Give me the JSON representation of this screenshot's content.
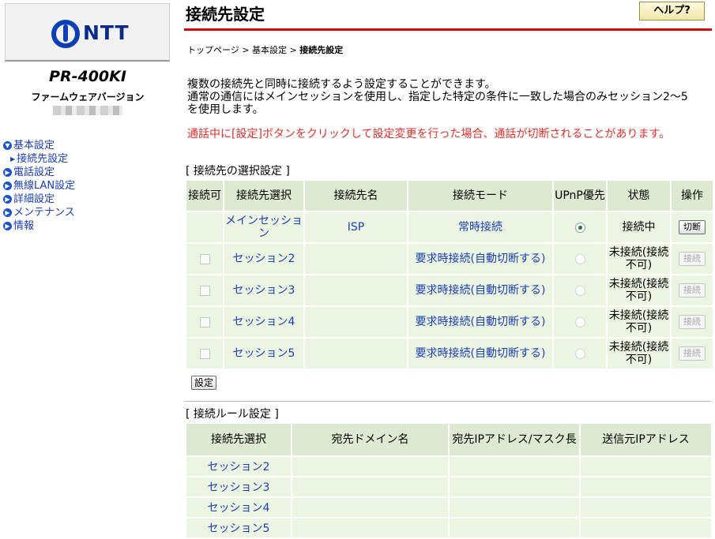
{
  "brand": {
    "logo_text": "NTT"
  },
  "device": {
    "model": "PR-400KI",
    "firmware_label": "ファームウェアバージョン"
  },
  "nav": {
    "basic": "基本設定",
    "basic_sub": "接続先設定",
    "phone": "電話設定",
    "wlan": "無線LAN設定",
    "detail": "詳細設定",
    "maint": "メンテナンス",
    "info": "情報"
  },
  "header": {
    "title": "接続先設定",
    "help": "ヘルプ?"
  },
  "breadcrumb": {
    "home": "トップページ",
    "sep1": " > ",
    "basic": "基本設定",
    "sep2": " > ",
    "current": "接続先設定"
  },
  "description": {
    "line1": "複数の接続先と同時に接続するよう設定することができます。",
    "line2": "通常の通信にはメインセッションを使用し、指定した特定の条件に一致した場合のみセッション2〜5",
    "line3": "を使用します。",
    "warning": "通話中に[設定]ボタンをクリックして設定変更を行った場合、通話が切断されることがあります。"
  },
  "selection": {
    "label": "[ 接続先の選択設定 ]",
    "headers": [
      "接続可",
      "接続先選択",
      "接続先名",
      "接続モード",
      "UPnP優先",
      "状態",
      "操作"
    ],
    "rows": [
      {
        "session": "メインセッション",
        "name": "ISP",
        "mode": "常時接続",
        "status": "接続中",
        "action": "切断"
      },
      {
        "session": "セッション2",
        "name": "",
        "mode": "要求時接続(自動切断する)",
        "status": "未接続(接続不可)",
        "action": "接続"
      },
      {
        "session": "セッション3",
        "name": "",
        "mode": "要求時接続(自動切断する)",
        "status": "未接続(接続不可)",
        "action": "接続"
      },
      {
        "session": "セッション4",
        "name": "",
        "mode": "要求時接続(自動切断する)",
        "status": "未接続(接続不可)",
        "action": "接続"
      },
      {
        "session": "セッション5",
        "name": "",
        "mode": "要求時接続(自動切断する)",
        "status": "未接続(接続不可)",
        "action": "接続"
      }
    ],
    "set_button": "設定"
  },
  "rules": {
    "label": "[ 接続ルール設定 ]",
    "headers": [
      "接続先選択",
      "宛先ドメイン名",
      "宛先IPアドレス/マスク長",
      "送信元IPアドレス"
    ],
    "rows": [
      {
        "session": "セッション2"
      },
      {
        "session": "セッション3"
      },
      {
        "session": "セッション4"
      },
      {
        "session": "セッション5"
      }
    ]
  },
  "colors": {
    "accent_rule": "#d40000",
    "link": "#1a3fb5",
    "warning": "#e0302a",
    "header_cell": "#dde9d0",
    "body_cell": "#ecf4e2"
  }
}
